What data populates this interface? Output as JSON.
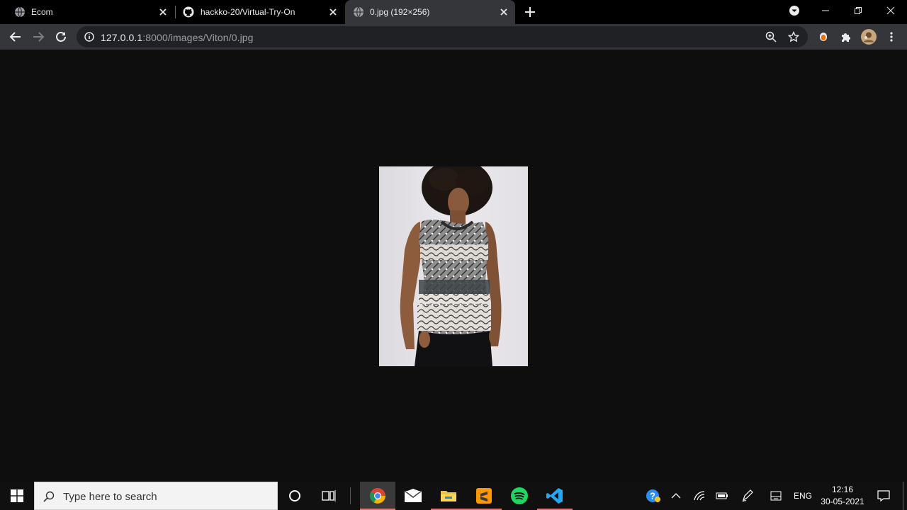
{
  "browser": {
    "tabs": [
      {
        "title": "Ecom",
        "icon": "globe-icon",
        "active": false
      },
      {
        "title": "hackko-20/Virtual-Try-On",
        "icon": "github-icon",
        "active": false
      },
      {
        "title": "0.jpg (192×256)",
        "icon": "globe-icon",
        "active": true
      }
    ],
    "address": {
      "host": "127.0.0.1",
      "rest": ":8000/images/Viton/0.jpg"
    }
  },
  "image": {
    "description_icon": "photo-of-woman-in-patterned-tank-top"
  },
  "taskbar": {
    "search_placeholder": "Type here to search",
    "apps": [
      "chrome-icon",
      "mail-icon",
      "file-explorer-icon",
      "sublime-text-icon",
      "spotify-icon",
      "vscode-icon"
    ],
    "language": "ENG",
    "time": "12:16",
    "date": "30-05-2021"
  },
  "colors": {
    "accent_running": "#e57373",
    "page_bg": "#0e0e0e",
    "toolbar_bg": "#35363a"
  }
}
